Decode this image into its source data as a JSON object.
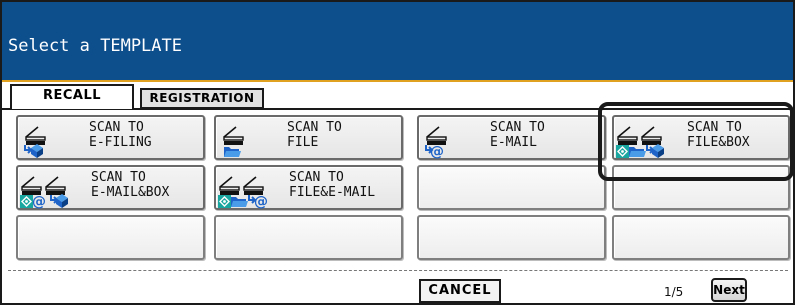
{
  "header": {
    "title": "Select a TEMPLATE"
  },
  "tabs": {
    "recall": "RECALL",
    "registration": "REGISTRATION"
  },
  "templates": [
    {
      "line1": "SCAN TO",
      "line2": "E-FILING",
      "icon": "scan-to-efiling-icon"
    },
    {
      "line1": "SCAN TO",
      "line2": "FILE",
      "icon": "scan-to-file-icon"
    },
    {
      "line1": "SCAN TO",
      "line2": "E-MAIL",
      "icon": "scan-to-email-icon"
    },
    {
      "line1": "SCAN TO",
      "line2": "FILE&BOX",
      "icon": "scan-to-file-and-box-icon"
    },
    {
      "line1": "SCAN TO",
      "line2": "E-MAIL&BOX",
      "icon": "scan-to-email-and-box-icon"
    },
    {
      "line1": "SCAN TO",
      "line2": "FILE&E-MAIL",
      "icon": "scan-to-file-and-email-icon"
    }
  ],
  "footer": {
    "cancel": "CANCEL",
    "page": "1/5",
    "next": "Next"
  },
  "colors": {
    "header_bg": "#0d4e8c",
    "accent_line": "#e0a020",
    "icon_blue": "#1e64c8",
    "icon_teal": "#1aa6a0"
  }
}
